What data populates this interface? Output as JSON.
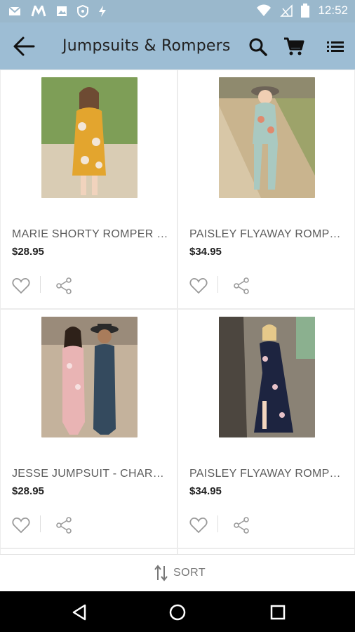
{
  "status_bar": {
    "time": "12:52",
    "left_icons": [
      "mail-icon",
      "m-app-icon",
      "image-icon",
      "shield-icon",
      "flash-icon"
    ],
    "right_icons": [
      "wifi-icon",
      "no-signal-icon",
      "battery-icon"
    ]
  },
  "app_bar": {
    "title": "Jumpsuits & Rompers",
    "icons": [
      "back-arrow-icon",
      "search-icon",
      "cart-icon",
      "list-icon"
    ]
  },
  "products": [
    {
      "name": "MARIE SHORTY ROMPER - MUSTARD",
      "price": "$28.95",
      "photo_colors": [
        "#d9c7a6",
        "#e3a52e",
        "#6c8f3e"
      ]
    },
    {
      "name": "PAISLEY FLYAWAY ROMPER - MINT",
      "price": "$34.95",
      "photo_colors": [
        "#c9b48e",
        "#a9c9c1",
        "#7d8b53"
      ]
    },
    {
      "name": "JESSE JUMPSUIT - CHARCOAL",
      "price": "$28.95",
      "photo_colors": [
        "#b9a48c",
        "#e9b4b4",
        "#344a5e"
      ]
    },
    {
      "name": "PAISLEY FLYAWAY ROMPER - NAVY",
      "price": "$34.95",
      "photo_colors": [
        "#8b8173",
        "#1d2440",
        "#7a8e52"
      ]
    }
  ],
  "sort": {
    "label": "SORT"
  },
  "colors": {
    "app_bar": "#9dbdd4",
    "status_bar": "#9ab8cc",
    "accent_text": "#5c5c5c"
  }
}
